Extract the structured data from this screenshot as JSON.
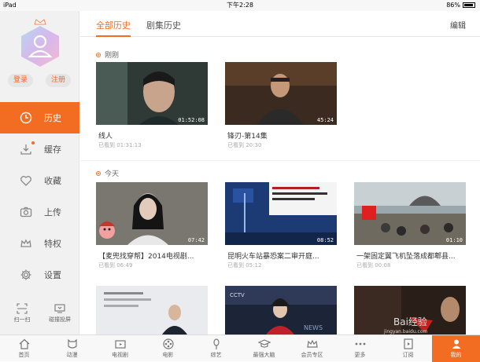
{
  "status_bar": {
    "device": "iPad",
    "time": "下午2:28",
    "battery": "86%"
  },
  "sidebar": {
    "login_label": "登录",
    "register_label": "注册",
    "items": [
      {
        "label": "历史",
        "icon": "clock-icon",
        "active": true
      },
      {
        "label": "缓存",
        "icon": "download-icon",
        "active": false,
        "badge": true
      },
      {
        "label": "收藏",
        "icon": "heart-icon",
        "active": false
      },
      {
        "label": "上传",
        "icon": "camera-icon",
        "active": false
      },
      {
        "label": "特权",
        "icon": "crown-icon",
        "active": false
      },
      {
        "label": "设置",
        "icon": "gear-icon",
        "active": false
      }
    ],
    "tools": [
      {
        "label": "扫一扫",
        "icon": "scan-icon"
      },
      {
        "label": "碰撞投屏",
        "icon": "screen-cast-icon"
      }
    ]
  },
  "tabs": [
    {
      "label": "全部历史",
      "active": true
    },
    {
      "label": "剧集历史",
      "active": false
    }
  ],
  "edit_label": "编辑",
  "sections": [
    {
      "label": "刚刚",
      "items": [
        {
          "title": "线人",
          "duration": "01:52:08",
          "progress": "已看到 01:31:13",
          "thumb": "#3a4a44"
        },
        {
          "title": "锋刃-第14集",
          "duration": "45:24",
          "progress": "已看到 20:30",
          "thumb": "#3b2a20"
        }
      ]
    },
    {
      "label": "今天",
      "items": [
        {
          "title": "【麦兜找穿帮】2014电视剧...",
          "duration": "07:42",
          "progress": "已看到 06:49",
          "thumb": "#5a5a55"
        },
        {
          "title": "昆明火车站暴恐案二审开庭...",
          "duration": "08:52",
          "progress": "已看到 05:12",
          "thumb": "#1e3f7a"
        },
        {
          "title": "一架固定翼飞机坠落成都郫县...",
          "duration": "01:10",
          "progress": "已看到 00:08",
          "thumb": "#7a8a90"
        }
      ]
    }
  ],
  "row3_thumbs": [
    "#e9ebee",
    "#1c2438",
    "#3a2a22"
  ],
  "row3_overlay": {
    "cctv": "CCTV",
    "news": "NEWS",
    "watermark": "Bai经验",
    "watermark_url": "jingyan.baidu.com"
  },
  "bottom_nav": [
    {
      "label": "首页",
      "icon": "home-icon",
      "active": false
    },
    {
      "label": "动漫",
      "icon": "anime-icon",
      "active": false
    },
    {
      "label": "电视剧",
      "icon": "tv-series-icon",
      "active": false
    },
    {
      "label": "电影",
      "icon": "movie-icon",
      "active": false
    },
    {
      "label": "综艺",
      "icon": "variety-icon",
      "active": false
    },
    {
      "label": "最强大脑",
      "icon": "brain-icon",
      "active": false
    },
    {
      "label": "会员专区",
      "icon": "vip-icon",
      "active": false
    },
    {
      "label": "更多",
      "icon": "more-icon",
      "active": false
    },
    {
      "label": "订阅",
      "icon": "subscribe-icon",
      "active": false
    },
    {
      "label": "我的",
      "icon": "profile-icon",
      "active": true
    }
  ],
  "colors": {
    "accent": "#f26c22",
    "sidebar_bg": "#f1f1f1"
  }
}
